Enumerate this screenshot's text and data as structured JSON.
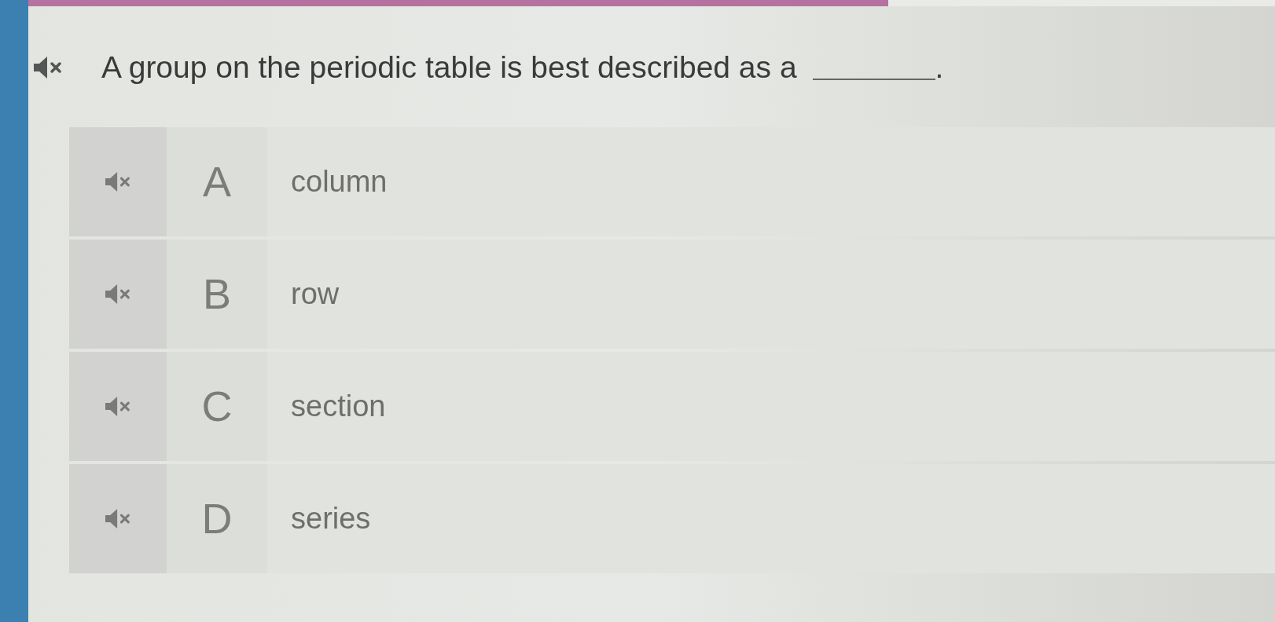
{
  "progress": {
    "level": 0.69
  },
  "question": {
    "text": "A group on the periodic table is best described as a",
    "text_after": "."
  },
  "options": [
    {
      "letter": "A",
      "text": "column"
    },
    {
      "letter": "B",
      "text": "row"
    },
    {
      "letter": "C",
      "text": "section"
    },
    {
      "letter": "D",
      "text": "series"
    }
  ]
}
